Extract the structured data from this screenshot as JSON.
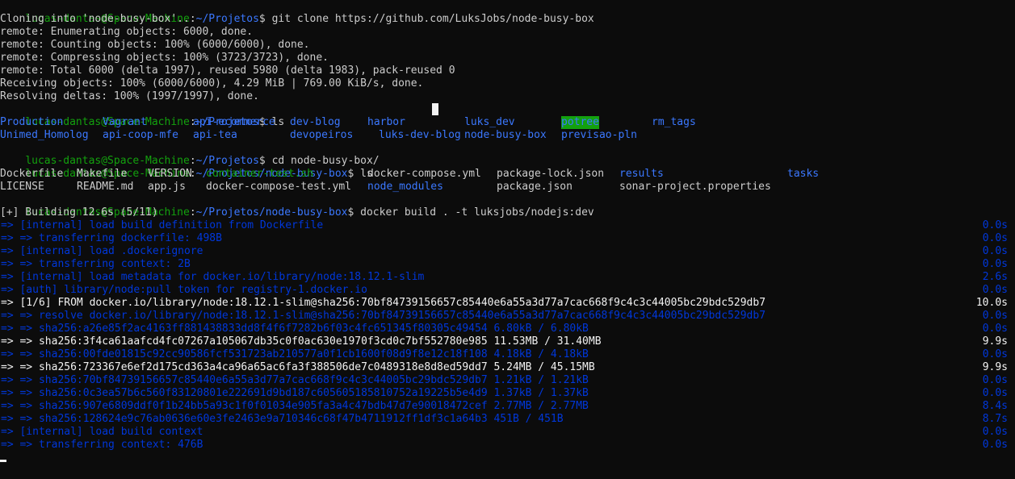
{
  "prompts": [
    {
      "user": "lucas-dantas@Space-Machine",
      "sep": ":",
      "path": "~/Projetos",
      "sym": "$ ",
      "cmd": "git clone https://github.com/LuksJobs/node-busy-box"
    },
    {
      "user": "lucas-dantas@Space-Machine",
      "sep": ":",
      "path": "~/Projetos",
      "sym": "$ ",
      "cmd": "ls"
    },
    {
      "user": "lucas-dantas@Space-Machine",
      "sep": ":",
      "path": "~/Projetos",
      "sym": "$ ",
      "cmd": "cd node-busy-box/"
    },
    {
      "user": "lucas-dantas@Space-Machine",
      "sep": ":",
      "path": "~/Projetos/node-busy-box",
      "sym": "$ ",
      "cmd": "ls"
    },
    {
      "user": "lucas-dantas@Space-Machine",
      "sep": ":",
      "path": "~/Projetos/node-busy-box",
      "sym": "$ ",
      "cmd": "docker build . -t luksjobs/nodejs:dev"
    }
  ],
  "clone_output": [
    "Cloning into 'node-busy-box'...",
    "remote: Enumerating objects: 6000, done.",
    "remote: Counting objects: 100% (6000/6000), done.",
    "remote: Compressing objects: 100% (3723/3723), done.",
    "remote: Total 6000 (delta 1997), reused 5980 (delta 1983), pack-reused 0",
    "Receiving objects: 100% (6000/6000), 4.29 MiB | 769.00 KiB/s, done.",
    "Resolving deltas: 100% (1997/1997), done."
  ],
  "ls_projetos": [
    [
      "Production",
      "Vagrant",
      "api-ecommerce",
      "dev-blog",
      "harbor",
      "luks_dev",
      "potree",
      "rm_tags"
    ],
    [
      "Unimed_Homolog",
      "api-coop-mfe",
      "api-tea",
      "devopeiros",
      "luks-dev-blog",
      "node-busy-box",
      "previsao-pln"
    ]
  ],
  "ls_nodebusybox": [
    [
      "Dockerfile",
      "Makefile",
      "VERSION",
      "container-test.sh",
      "docker-compose.yml",
      "package-lock.json",
      "results",
      "tasks"
    ],
    [
      "LICENSE",
      "README.md",
      "app.js",
      "docker-compose-test.yml",
      "node_modules",
      "package.json",
      "sonar-project.properties"
    ]
  ],
  "build_header": "[+] Building 12.6s (5/11)",
  "build_steps": [
    {
      "text": "=> [internal] load build definition from Dockerfile",
      "time": "0.0s",
      "done": true
    },
    {
      "text": "=> => transferring dockerfile: 498B",
      "time": "0.0s",
      "done": true
    },
    {
      "text": "=> [internal] load .dockerignore",
      "time": "0.0s",
      "done": true
    },
    {
      "text": "=> => transferring context: 2B",
      "time": "0.0s",
      "done": true
    },
    {
      "text": "=> [internal] load metadata for docker.io/library/node:18.12.1-slim",
      "time": "2.6s",
      "done": true
    },
    {
      "text": "=> [auth] library/node:pull token for registry-1.docker.io",
      "time": "0.0s",
      "done": true
    },
    {
      "text": "=> [1/6] FROM docker.io/library/node:18.12.1-slim@sha256:70bf84739156657c85440e6a55a3d77a7cac668f9c4c3c44005bc29bdc529db7",
      "time": "10.0s",
      "done": false
    },
    {
      "text": "=> => resolve docker.io/library/node:18.12.1-slim@sha256:70bf84739156657c85440e6a55a3d77a7cac668f9c4c3c44005bc29bdc529db7",
      "time": "0.0s",
      "done": true
    },
    {
      "text": "=> => sha256:a26e85f2ac4163ff881438833dd8f4f6f7282b6f03c4fc651345f80305c49454 6.80kB / 6.80kB",
      "time": "0.0s",
      "done": true
    },
    {
      "text": "=> => sha256:3f4ca61aafcd4fc07267a105067db35c0f0ac630e1970f3cd0c7bf552780e985 11.53MB / 31.40MB",
      "time": "9.9s",
      "done": false
    },
    {
      "text": "=> => sha256:00fde01815c92cc90586fcf531723ab210577a0f1cb1600f08d9f8e12c18f108 4.18kB / 4.18kB",
      "time": "0.0s",
      "done": true
    },
    {
      "text": "=> => sha256:723367e6ef2d175cd363a4ca96a65ac6fa3f388506de7c0489318e8d8ed59dd7 5.24MB / 45.15MB",
      "time": "9.9s",
      "done": false
    },
    {
      "text": "=> => sha256:70bf84739156657c85440e6a55a3d77a7cac668f9c4c3c44005bc29bdc529db7 1.21kB / 1.21kB",
      "time": "0.0s",
      "done": true
    },
    {
      "text": "=> => sha256:0c3ea57b6c560f83120801e222691d9bd187c605605185810752a19225b5e4d9 1.37kB / 1.37kB",
      "time": "0.0s",
      "done": true
    },
    {
      "text": "=> => sha256:907e6809ddf0f1b24bb5a93c1f0f01034e905fa3a4c47bdb47d7e90018472cef 2.77MB / 2.77MB",
      "time": "8.4s",
      "done": true
    },
    {
      "text": "=> => sha256:128624e9c76ab0636e60e3fe2463e9a710346c68f47b4711912ff1df3c1a64b3 451B / 451B",
      "time": "8.7s",
      "done": true
    },
    {
      "text": "=> [internal] load build context",
      "time": "0.0s",
      "done": true
    },
    {
      "text": "=> => transferring context: 476B",
      "time": "0.0s",
      "done": true
    }
  ],
  "colors": {
    "background": "#0c0c0c",
    "prompt_user": "#13a10e",
    "prompt_path": "#3b78ff",
    "text": "#cccccc",
    "directory": "#3b78ff",
    "executable": "#13a10e",
    "highlight_bg": "#13a10e",
    "build_done": "#0037da",
    "build_active": "#f2f2f2"
  }
}
